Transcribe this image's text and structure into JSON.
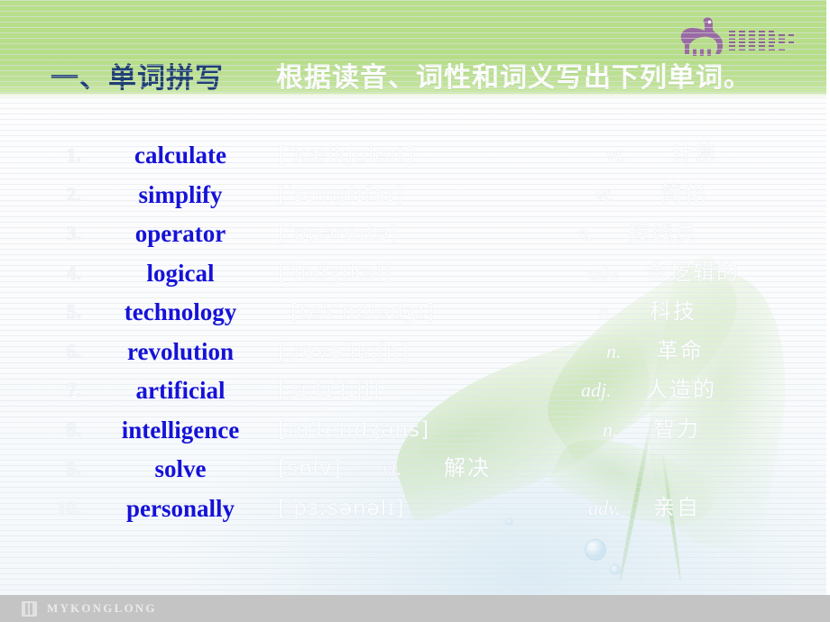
{
  "header": {
    "title_main": "一、单词拼写",
    "title_sub": "根据读音、词性和词义写出下列单词。",
    "logo_alt": "dinosaur-logo",
    "bg_color": "#b6dd88",
    "title_color": "#1f3f74",
    "subtitle_color": "#ffffff"
  },
  "colors": {
    "word_blue": "#1512d8",
    "header_green": "#b6dd88",
    "footer_gray": "#c4c4c4",
    "ghost_white": "#fbfcfd"
  },
  "rows": [
    {
      "num": "1.",
      "word": "calculate",
      "phonetic": "[ˈkælkjuleɪt]",
      "pos": "vt.",
      "meaning": "计算"
    },
    {
      "num": "2.",
      "word": "simplify",
      "phonetic": "[ˈsɪmplɪfaɪ]",
      "pos": "vt.",
      "meaning": "简化"
    },
    {
      "num": "3.",
      "word": "operator",
      "phonetic": "[ˈɒpəreɪtə]",
      "pos": "n.",
      "meaning": "接线员"
    },
    {
      "num": "4.",
      "word": "logical",
      "phonetic": "[ˈlɒdʒɪkəl]",
      "pos": "adv.",
      "meaning": "合逻辑的"
    },
    {
      "num": "5.",
      "word": "technology",
      "phonetic": "[tekˈnɒlədʒɪ]",
      "pos": "n.",
      "meaning": "科技"
    },
    {
      "num": "6.",
      "word": "revolution",
      "phonetic": "[ˌrevəˈluːʃn]",
      "pos": "n.",
      "meaning": "革命"
    },
    {
      "num": "7.",
      "word": "artificial",
      "phonetic": "[ˌɑːtɪˈfɪʃl]",
      "pos": "adj.",
      "meaning": "人造的"
    },
    {
      "num": "8.",
      "word": "intelligence",
      "phonetic": "[ɪnˈtelɪdʒəns]",
      "pos": "n.",
      "meaning": "智力"
    },
    {
      "num": "9.",
      "word": "solve",
      "phonetic": "[sɒlv]",
      "pos": "vt.",
      "meaning": "解决"
    },
    {
      "num": "10.",
      "word": "personally",
      "phonetic": "[ˈpɜːsənəlɪ]",
      "pos": "adv.",
      "meaning": "亲自"
    }
  ],
  "footer": {
    "brand": "MYKONGLONG",
    "mark_alt": "mykonglong-mark"
  }
}
